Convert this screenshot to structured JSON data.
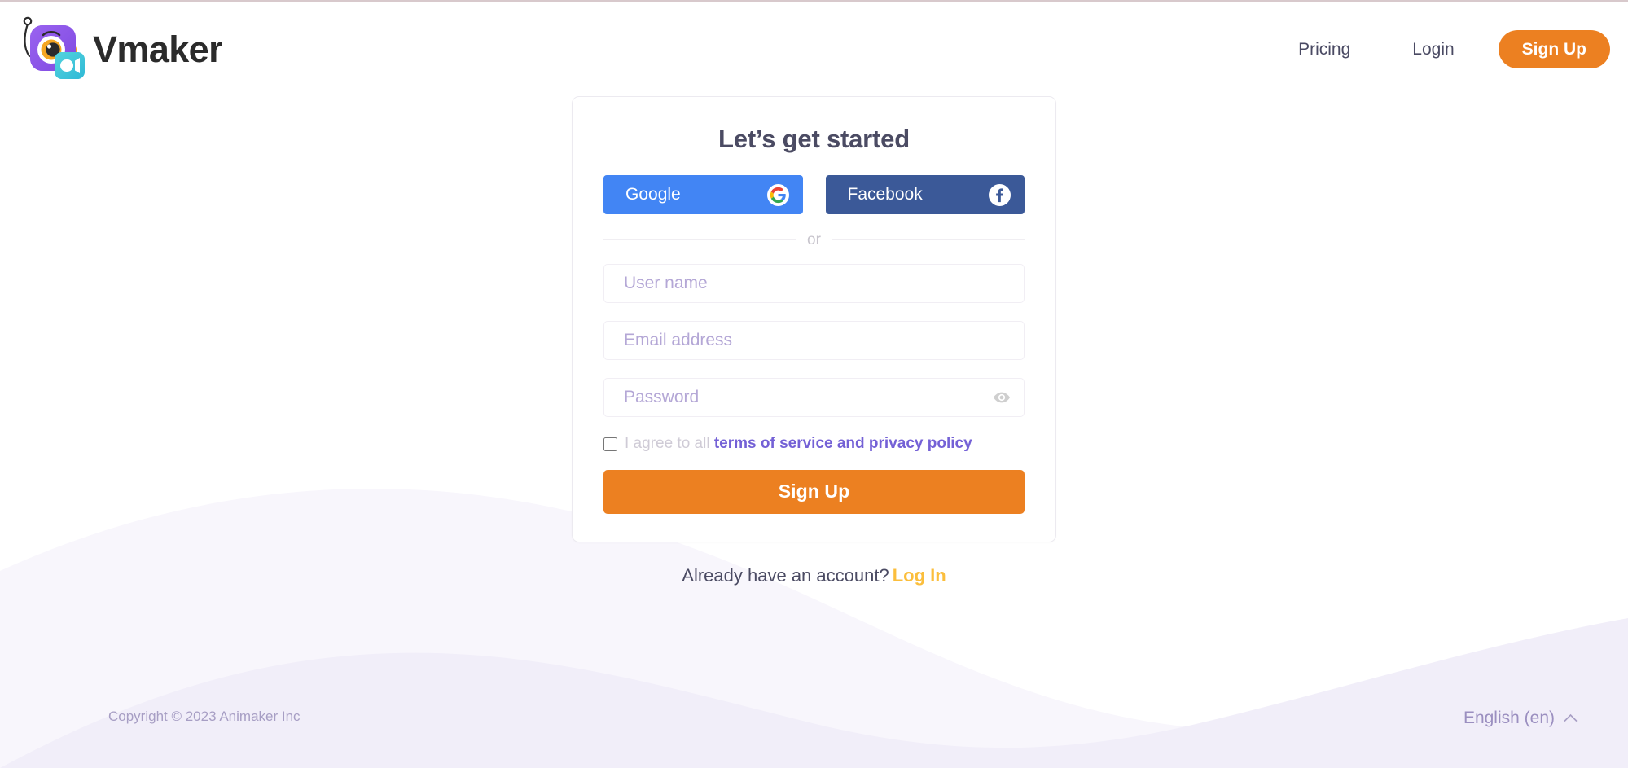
{
  "brand": {
    "name": "Vmaker",
    "logo_icon": "vmaker-camera-logo-icon"
  },
  "header": {
    "nav": [
      {
        "label": "Pricing",
        "name": "nav-link-pricing"
      },
      {
        "label": "Login",
        "name": "nav-link-login"
      }
    ],
    "signup_label": "Sign Up"
  },
  "card": {
    "title": "Let’s get started",
    "social": [
      {
        "label": "Google",
        "icon": "google-icon",
        "color": "#4285f4"
      },
      {
        "label": "Facebook",
        "icon": "facebook-icon",
        "color": "#3b5998"
      }
    ],
    "divider_label": "or",
    "fields": [
      {
        "name": "username-input",
        "placeholder": "User name",
        "value": "",
        "type": "text"
      },
      {
        "name": "email-input",
        "placeholder": "Email address",
        "value": "",
        "type": "text"
      },
      {
        "name": "password-input",
        "placeholder": "Password",
        "value": "",
        "type": "password"
      }
    ],
    "terms": {
      "checked": false,
      "prefix": "I agree to all ",
      "link": "terms of service and privacy policy"
    },
    "submit_label": "Sign Up"
  },
  "below_card": {
    "account_prompt": "Already have an account?",
    "account_link": "Log In"
  },
  "footer": {
    "copyright": "Copyright © 2023 Animaker Inc",
    "language": "English (en)",
    "language_caret": "chevron-up-icon"
  },
  "colors": {
    "accent_orange": "#ec8021",
    "google_blue": "#4285f4",
    "facebook_blue": "#3b5998",
    "link_purple": "#7461d6",
    "login_amber": "#fbbe3c",
    "placeholder_purple": "#b4a7d6",
    "wave_light": "#f7f5fb",
    "wave_dark": "#f0edf8"
  }
}
